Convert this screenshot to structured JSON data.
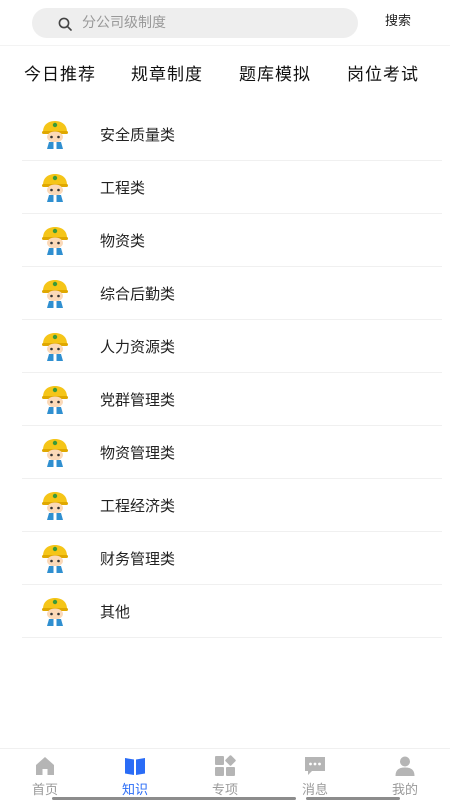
{
  "search": {
    "placeholder": "分公司级制度",
    "button_label": "搜索"
  },
  "tabs": [
    {
      "label": "今日推荐"
    },
    {
      "label": "规章制度"
    },
    {
      "label": "题库模拟"
    },
    {
      "label": "岗位考试"
    }
  ],
  "categories": [
    {
      "label": "安全质量类",
      "icon": "worker-avatar-icon"
    },
    {
      "label": "工程类",
      "icon": "worker-avatar-icon"
    },
    {
      "label": "物资类",
      "icon": "worker-avatar-icon"
    },
    {
      "label": "综合后勤类",
      "icon": "worker-avatar-icon"
    },
    {
      "label": "人力资源类",
      "icon": "worker-avatar-icon"
    },
    {
      "label": "党群管理类",
      "icon": "worker-avatar-icon"
    },
    {
      "label": "物资管理类",
      "icon": "worker-avatar-icon"
    },
    {
      "label": "工程经济类",
      "icon": "worker-avatar-icon"
    },
    {
      "label": "财务管理类",
      "icon": "worker-avatar-icon"
    },
    {
      "label": "其他",
      "icon": "worker-avatar-icon"
    }
  ],
  "tabbar": [
    {
      "label": "首页",
      "icon": "home-icon",
      "active": false
    },
    {
      "label": "知识",
      "icon": "book-icon",
      "active": true
    },
    {
      "label": "专项",
      "icon": "grid-icon",
      "active": false
    },
    {
      "label": "消息",
      "icon": "message-icon",
      "active": false
    },
    {
      "label": "我的",
      "icon": "user-icon",
      "active": false
    }
  ],
  "colors": {
    "accent": "#2a6cf6",
    "inactive": "#9a9a9a",
    "helmet": "#f5c518",
    "uniform": "#2f8fd0"
  }
}
